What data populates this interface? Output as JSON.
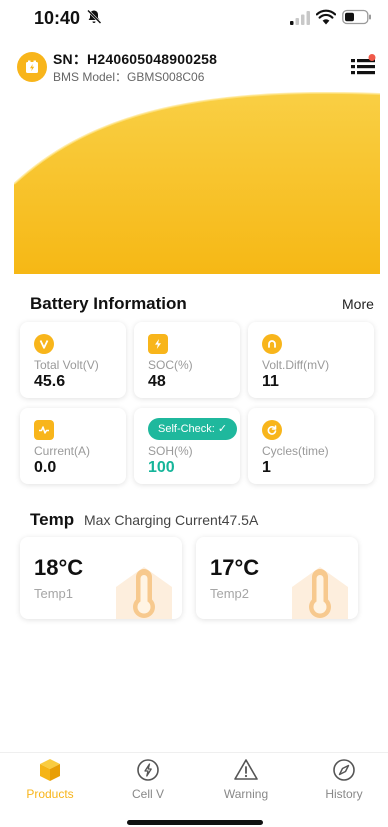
{
  "status_bar": {
    "time": "10:40"
  },
  "header": {
    "sn_label": "SN：H240605048900258",
    "bms_label": "BMS Model：GBMS008C06"
  },
  "battery_info": {
    "title": "Battery Information",
    "more_label": "More",
    "cards": [
      {
        "icon": "volt-icon",
        "label": "Total Volt(V)",
        "value": "45.6"
      },
      {
        "icon": "lightning-icon",
        "label": "SOC(%)",
        "value": "48"
      },
      {
        "icon": "volt-diff-icon",
        "label": "Volt.Diff(mV)",
        "value": "11"
      },
      {
        "icon": "current-icon",
        "label": "Current(A)",
        "value": "0.0"
      },
      {
        "badge": "Self-Check: ✓",
        "label": "SOH(%)",
        "value": "100"
      },
      {
        "icon": "cycle-icon",
        "label": "Cycles(time)",
        "value": "1"
      }
    ]
  },
  "temp": {
    "title": "Temp",
    "subtitle": "Max  Charging Current47.5A",
    "items": [
      {
        "value": "18°C",
        "name": "Temp1"
      },
      {
        "value": "17°C",
        "name": "Temp2"
      }
    ]
  },
  "tabs": [
    {
      "label": "Products",
      "icon": "cube-icon",
      "active": true
    },
    {
      "label": "Cell V",
      "icon": "lightning-circle-icon",
      "active": false
    },
    {
      "label": "Warning",
      "icon": "warning-icon",
      "active": false
    },
    {
      "label": "History",
      "icon": "compass-icon",
      "active": false
    }
  ],
  "colors": {
    "accent": "#f8b51b",
    "teal": "#16b59a",
    "notification": "#f05a4a"
  }
}
